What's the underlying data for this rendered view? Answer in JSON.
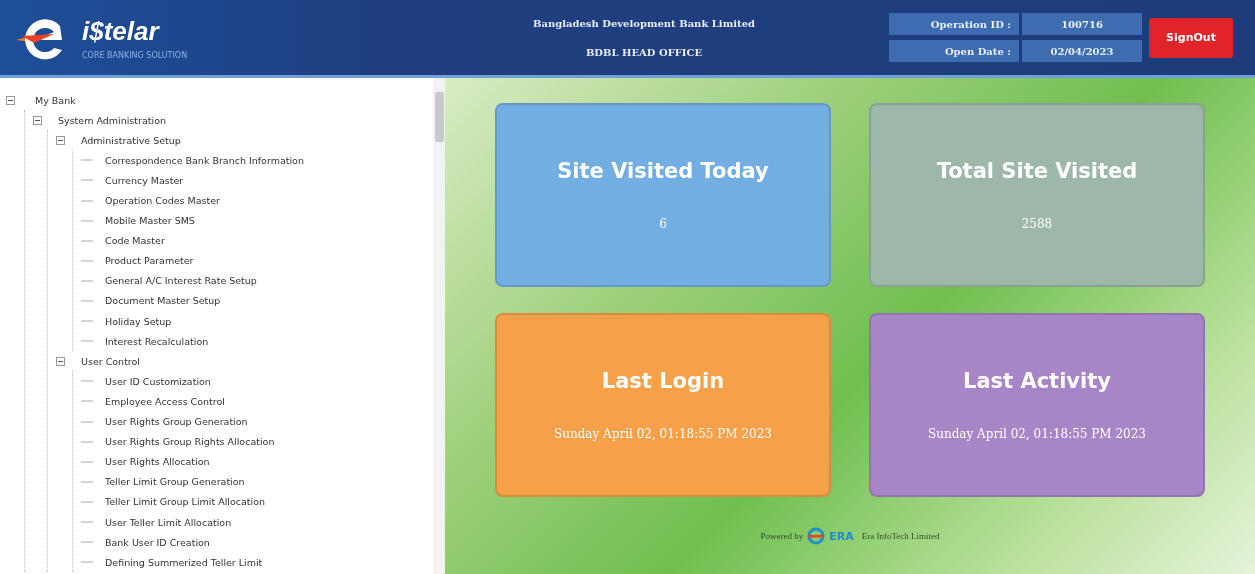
{
  "header": {
    "logo_text": "i$telar",
    "tagline": "CORE BANKING SOLUTION",
    "bank_name": "Bangladesh Development Bank Limited",
    "branch": "BDBL HEAD OFFICE",
    "info": [
      {
        "label": "Operation ID :",
        "value": "100716"
      },
      {
        "label": "Open Date :",
        "value": "02/04/2023"
      }
    ],
    "signout": "SignOut"
  },
  "tree": [
    {
      "label": "My Bank",
      "expanded": true,
      "children": [
        {
          "label": "System Administration",
          "expanded": true,
          "children": [
            {
              "label": "Administrative Setup",
              "expanded": true,
              "children": [
                {
                  "label": "Correspondence Bank Branch Information"
                },
                {
                  "label": "Currency Master"
                },
                {
                  "label": "Operation Codes Master"
                },
                {
                  "label": "Mobile Master SMS"
                },
                {
                  "label": "Code Master"
                },
                {
                  "label": "Product Parameter"
                },
                {
                  "label": "General A/C Interest Rate Setup"
                },
                {
                  "label": "Document Master Setup"
                },
                {
                  "label": "Holiday Setup"
                },
                {
                  "label": "Interest Recalculation"
                }
              ]
            },
            {
              "label": "User Control",
              "expanded": true,
              "children": [
                {
                  "label": "User ID Customization"
                },
                {
                  "label": "Employee Access Control"
                },
                {
                  "label": "User Rights Group Generation"
                },
                {
                  "label": "User Rights Group Rights Allocation"
                },
                {
                  "label": "User Rights Allocation"
                },
                {
                  "label": "Teller Limit Group Generation"
                },
                {
                  "label": "Teller Limit Group Limit Allocation"
                },
                {
                  "label": "User Teller Limit Allocation"
                },
                {
                  "label": "Bank User ID Creation"
                },
                {
                  "label": "Defining Summerized Teller Limit"
                }
              ]
            }
          ]
        }
      ]
    }
  ],
  "cards": [
    {
      "title": "Site Visited Today",
      "value": "6",
      "color": "#72aee2"
    },
    {
      "title": "Total Site Visited",
      "value": "2588",
      "color": "#9db8a8"
    },
    {
      "title": "Last Login",
      "value": "Sunday April 02, 01:18:55 PM 2023",
      "color": "#f7a04a"
    },
    {
      "title": "Last Activity",
      "value": "Sunday April 02, 01:18:55 PM 2023",
      "color": "#a885c6"
    }
  ],
  "footer": {
    "powered_by": "Powered by",
    "era_logo_text": "ERA",
    "company": "Era InfoTech Limited"
  }
}
